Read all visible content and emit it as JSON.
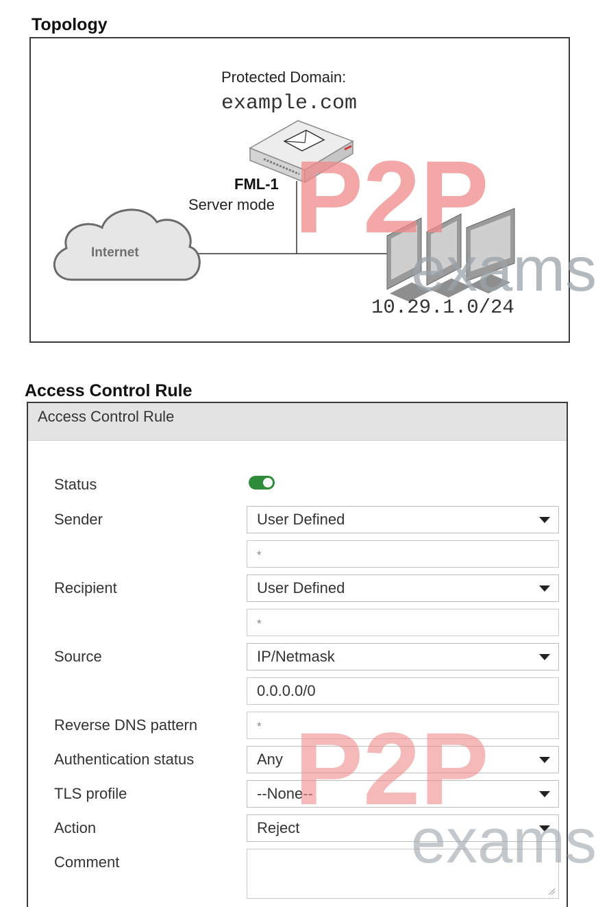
{
  "topology": {
    "title": "Topology",
    "domain_label": "Protected Domain:",
    "domain": "example.com",
    "device_name": "FML-1",
    "device_mode": "Server mode",
    "cloud_label": "Internet",
    "subnet": "10.29.1.0/24"
  },
  "watermark": {
    "brand": "P2P",
    "sub": "exams"
  },
  "access_control": {
    "section_title": "Access Control Rule",
    "panel_title": "Access Control Rule",
    "status": {
      "label": "Status",
      "enabled": true
    },
    "sender": {
      "label": "Sender",
      "type": "User Defined",
      "pattern": "*"
    },
    "recipient": {
      "label": "Recipient",
      "type": "User Defined",
      "pattern": "*"
    },
    "source": {
      "label": "Source",
      "type": "IP/Netmask",
      "value": "0.0.0.0/0"
    },
    "reverse_dns": {
      "label": "Reverse DNS pattern",
      "value": "*"
    },
    "auth_status": {
      "label": "Authentication status",
      "value": "Any"
    },
    "tls_profile": {
      "label": "TLS profile",
      "value": "--None--"
    },
    "action": {
      "label": "Action",
      "value": "Reject"
    },
    "comment": {
      "label": "Comment",
      "value": ""
    }
  },
  "colors": {
    "toggle_on": "#2e8b3a",
    "watermark_red": "#f08a8a",
    "watermark_gray": "#9aa3aa"
  }
}
